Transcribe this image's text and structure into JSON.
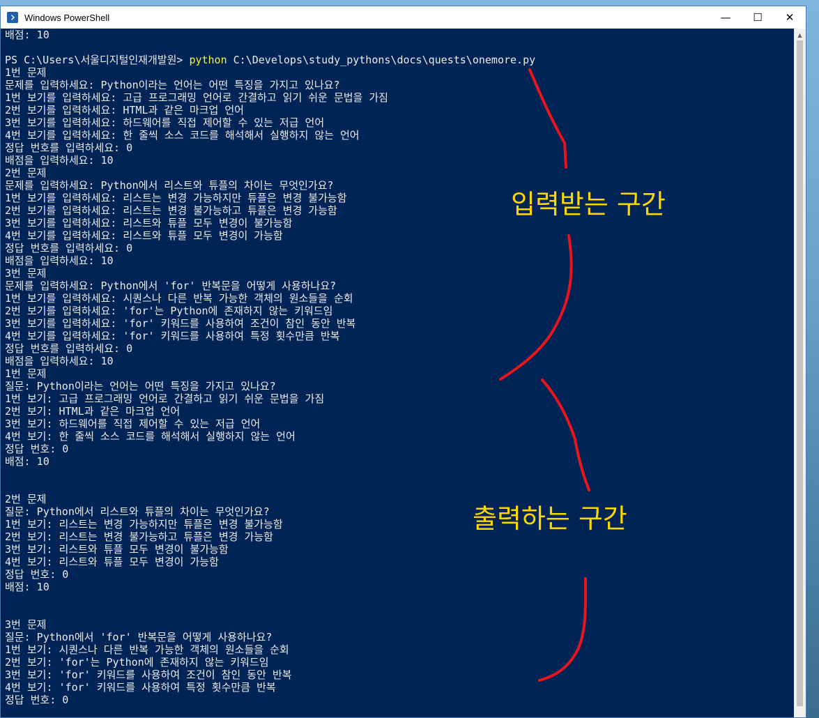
{
  "window": {
    "title": "Windows PowerShell"
  },
  "controls": {
    "minimize": "—",
    "maximize": "☐",
    "close": "✕"
  },
  "prompt": {
    "path": "PS C:\\Users\\서울디지털인재개발원> ",
    "command": "python",
    "args": " C:\\Develops\\study_pythons\\docs\\quests\\onemore.py"
  },
  "terminal_lines": [
    "배점: 10",
    "",
    "__PROMPT__",
    "1번 문제",
    "문제를 입력하세요: Python이라는 언어는 어떤 특징을 가지고 있나요?",
    "1번 보기를 입력하세요: 고급 프로그래밍 언어로 간결하고 읽기 쉬운 문법을 가짐",
    "2번 보기를 입력하세요: HTML과 같은 마크업 언어",
    "3번 보기를 입력하세요: 하드웨어를 직접 제어할 수 있는 저급 언어",
    "4번 보기를 입력하세요: 한 줄씩 소스 코드를 해석해서 실행하지 않는 언어",
    "정답 번호를 입력하세요: 0",
    "배점을 입력하세요: 10",
    "2번 문제",
    "문제를 입력하세요: Python에서 리스트와 튜플의 차이는 무엇인가요?",
    "1번 보기를 입력하세요: 리스트는 변경 가능하지만 튜플은 변경 불가능함",
    "2번 보기를 입력하세요: 리스트는 변경 불가능하고 튜플은 변경 가능함",
    "3번 보기를 입력하세요: 리스트와 튜플 모두 변경이 불가능함",
    "4번 보기를 입력하세요: 리스트와 튜플 모두 변경이 가능함",
    "정답 번호를 입력하세요: 0",
    "배점을 입력하세요: 10",
    "3번 문제",
    "문제를 입력하세요: Python에서 'for' 반복문을 어떻게 사용하나요?",
    "1번 보기를 입력하세요: 시퀀스나 다른 반복 가능한 객체의 원소들을 순회",
    "2번 보기를 입력하세요: 'for'는 Python에 존재하지 않는 키워드임",
    "3번 보기를 입력하세요: 'for' 키워드를 사용하여 조건이 참인 동안 반복",
    "4번 보기를 입력하세요: 'for' 키워드를 사용하여 특정 횟수만큼 반복",
    "정답 번호를 입력하세요: 0",
    "배점을 입력하세요: 10",
    "1번 문제",
    "질문: Python이라는 언어는 어떤 특징을 가지고 있나요?",
    "1번 보기: 고급 프로그래밍 언어로 간결하고 읽기 쉬운 문법을 가짐",
    "2번 보기: HTML과 같은 마크업 언어",
    "3번 보기: 하드웨어를 직접 제어할 수 있는 저급 언어",
    "4번 보기: 한 줄씩 소스 코드를 해석해서 실행하지 않는 언어",
    "정답 번호: 0",
    "배점: 10",
    "",
    "",
    "2번 문제",
    "질문: Python에서 리스트와 튜플의 차이는 무엇인가요?",
    "1번 보기: 리스트는 변경 가능하지만 튜플은 변경 불가능함",
    "2번 보기: 리스트는 변경 불가능하고 튜플은 변경 가능함",
    "3번 보기: 리스트와 튜플 모두 변경이 불가능함",
    "4번 보기: 리스트와 튜플 모두 변경이 가능함",
    "정답 번호: 0",
    "배점: 10",
    "",
    "",
    "3번 문제",
    "질문: Python에서 'for' 반복문을 어떻게 사용하나요?",
    "1번 보기: 시퀀스나 다른 반복 가능한 객체의 원소들을 순회",
    "2번 보기: 'for'는 Python에 존재하지 않는 키워드임",
    "3번 보기: 'for' 키워드를 사용하여 조건이 참인 동안 반복",
    "4번 보기: 'for' 키워드를 사용하여 특정 횟수만큼 반복",
    "정답 번호: 0"
  ],
  "annotations": {
    "input_section": "입력받는 구간",
    "output_section": "출력하는 구간",
    "label_color": "#ffd700",
    "stroke_color": "#e8151b"
  },
  "colors": {
    "terminal_bg": "#012456",
    "terminal_text": "#ececec",
    "command_highlight": "#f5f543"
  }
}
